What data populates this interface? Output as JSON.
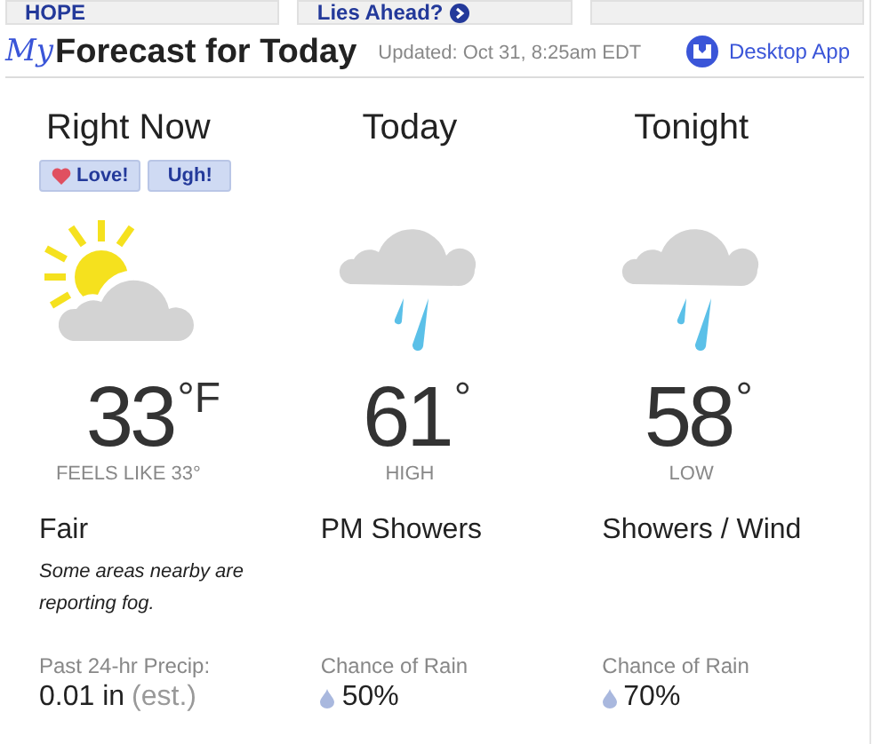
{
  "top_cards": [
    {
      "label": "HOPE",
      "has_icon": false
    },
    {
      "label": "Lies Ahead?",
      "has_icon": true
    }
  ],
  "header": {
    "logo": "My",
    "title": "Forecast for Today",
    "updated": "Updated: Oct 31, 8:25am EDT",
    "desktop_app": "Desktop App"
  },
  "reactions": [
    {
      "label": "Love!",
      "kind": "love"
    },
    {
      "label": "Ugh!",
      "kind": "ugh"
    }
  ],
  "periods": [
    {
      "title": "Right Now",
      "temp": "33",
      "unit": "°F",
      "sublabel": "FEELS LIKE 33°",
      "condition": "Fair",
      "note": "Some areas nearby are reporting fog.",
      "kind": "current",
      "stat_label": "Past 24-hr Precip:",
      "stat_value": "0.01 in",
      "stat_suffix": "(est.)"
    },
    {
      "title": "Today",
      "temp": "61",
      "unit": "°",
      "sublabel": "HIGH",
      "condition": "PM Showers",
      "kind": "forecast",
      "stat_label": "Chance of Rain",
      "stat_value": "50%"
    },
    {
      "title": "Tonight",
      "temp": "58",
      "unit": "°",
      "sublabel": "LOW",
      "condition": "Showers / Wind",
      "kind": "forecast",
      "stat_label": "Chance of Rain",
      "stat_value": "70%"
    }
  ]
}
